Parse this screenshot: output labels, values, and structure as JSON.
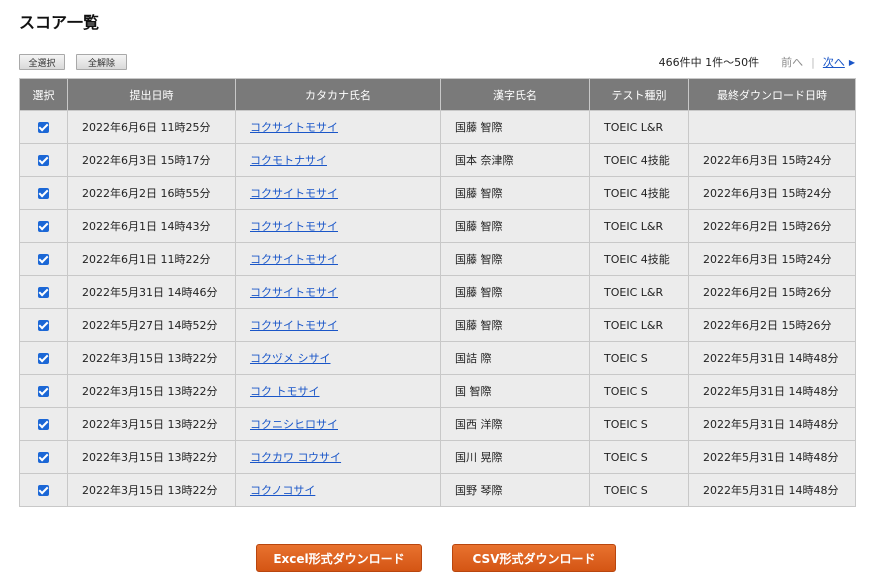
{
  "page": {
    "title": "スコア一覧"
  },
  "toolbar": {
    "select_all": "全選択",
    "deselect_all": "全解除",
    "summary": "466件中 1件～50件",
    "prev": "前へ",
    "next": "次へ",
    "next_arrow_icon": "triangle-right-icon"
  },
  "table": {
    "headers": [
      "選択",
      "提出日時",
      "カタカナ氏名",
      "漢字氏名",
      "テスト種別",
      "最終ダウンロード日時"
    ],
    "rows": [
      {
        "checked": true,
        "submitted": "2022年6月6日 11時25分",
        "kana": "コクサイトモサイ",
        "kanji": "国藤 智際",
        "test": "TOEIC L&R",
        "last_download": ""
      },
      {
        "checked": true,
        "submitted": "2022年6月3日 15時17分",
        "kana": "コクモトナサイ",
        "kanji": "国本 奈津際",
        "test": "TOEIC 4技能",
        "last_download": "2022年6月3日 15時24分"
      },
      {
        "checked": true,
        "submitted": "2022年6月2日 16時55分",
        "kana": "コクサイトモサイ",
        "kanji": "国藤 智際",
        "test": "TOEIC 4技能",
        "last_download": "2022年6月3日 15時24分"
      },
      {
        "checked": true,
        "submitted": "2022年6月1日 14時43分",
        "kana": "コクサイトモサイ",
        "kanji": "国藤 智際",
        "test": "TOEIC L&R",
        "last_download": "2022年6月2日 15時26分"
      },
      {
        "checked": true,
        "submitted": "2022年6月1日 11時22分",
        "kana": "コクサイトモサイ",
        "kanji": "国藤 智際",
        "test": "TOEIC 4技能",
        "last_download": "2022年6月3日 15時24分"
      },
      {
        "checked": true,
        "submitted": "2022年5月31日 14時46分",
        "kana": "コクサイトモサイ",
        "kanji": "国藤 智際",
        "test": "TOEIC L&R",
        "last_download": "2022年6月2日 15時26分"
      },
      {
        "checked": true,
        "submitted": "2022年5月27日 14時52分",
        "kana": "コクサイトモサイ",
        "kanji": "国藤 智際",
        "test": "TOEIC L&R",
        "last_download": "2022年6月2日 15時26分"
      },
      {
        "checked": true,
        "submitted": "2022年3月15日 13時22分",
        "kana": "コクヅメ シサイ",
        "kanji": "国詰 際",
        "test": "TOEIC S",
        "last_download": "2022年5月31日 14時48分"
      },
      {
        "checked": true,
        "submitted": "2022年3月15日 13時22分",
        "kana": "コク トモサイ",
        "kanji": "国 智際",
        "test": "TOEIC S",
        "last_download": "2022年5月31日 14時48分"
      },
      {
        "checked": true,
        "submitted": "2022年3月15日 13時22分",
        "kana": "コクニシヒロサイ",
        "kanji": "国西 洋際",
        "test": "TOEIC S",
        "last_download": "2022年5月31日 14時48分"
      },
      {
        "checked": true,
        "submitted": "2022年3月15日 13時22分",
        "kana": "コクカワ コウサイ",
        "kanji": "国川 晃際",
        "test": "TOEIC S",
        "last_download": "2022年5月31日 14時48分"
      },
      {
        "checked": true,
        "submitted": "2022年3月15日 13時22分",
        "kana": "コクノコサイ",
        "kanji": "国野 琴際",
        "test": "TOEIC S",
        "last_download": "2022年5月31日 14時48分"
      }
    ]
  },
  "downloads": {
    "excel": "Excel形式ダウンロード",
    "csv": "CSV形式ダウンロード"
  },
  "colors": {
    "header_bg": "#7a7a7a",
    "row_bg": "#ececec",
    "link": "#1a56c8",
    "checkbox": "#1b67d6",
    "download_button": "#e06a25"
  }
}
